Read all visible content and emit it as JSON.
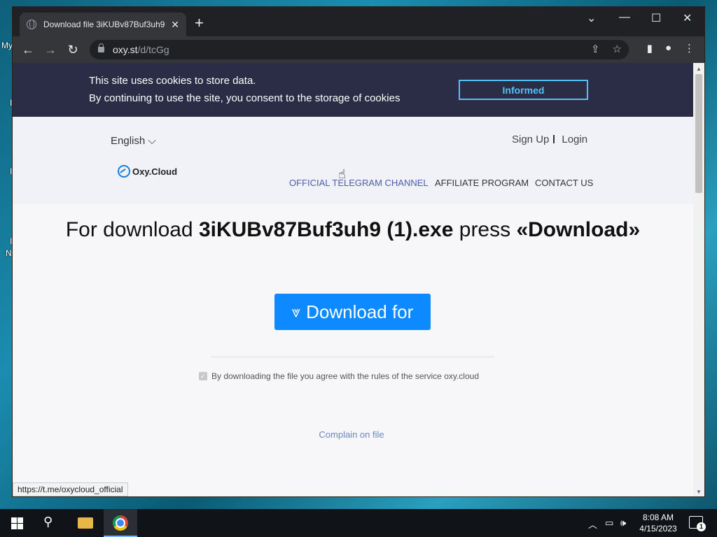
{
  "desktop": {
    "labels": [
      "My",
      "I",
      "I",
      "I",
      "N"
    ]
  },
  "browser": {
    "tab_title": "Download file 3iKUBv87Buf3uh9",
    "url_host": "oxy.st",
    "url_path": "/d/tcGg",
    "status_url": "https://t.me/oxycloud_official"
  },
  "cookie": {
    "line1": "This site uses cookies to store data.",
    "line2": "By continuing to use the site, you consent to the storage of cookies",
    "button": "Informed"
  },
  "header": {
    "language": "English",
    "sign_up": "Sign Up",
    "login": "Login",
    "logo_text": "Oxy.Cloud",
    "menu": [
      "OFFICIAL TELEGRAM CHANNEL",
      "AFFILIATE PROGRAM",
      "CONTACT US"
    ]
  },
  "main": {
    "headline_prefix": "For download ",
    "file_name": "3iKUBv87Buf3uh9 (1).exe",
    "headline_mid": " press ",
    "headline_action": "«Download»",
    "download_button": "Download for",
    "agree_text": "By downloading the file you agree with the rules of the service oxy.cloud",
    "agree_checked": true,
    "complain": "Complain on file"
  },
  "taskbar": {
    "time": "8:08 AM",
    "date": "4/15/2023",
    "notifications": "1"
  },
  "colors": {
    "cookie_bg": "#2a2d45",
    "accent": "#0d8aff",
    "informed": "#4fc3f7"
  }
}
